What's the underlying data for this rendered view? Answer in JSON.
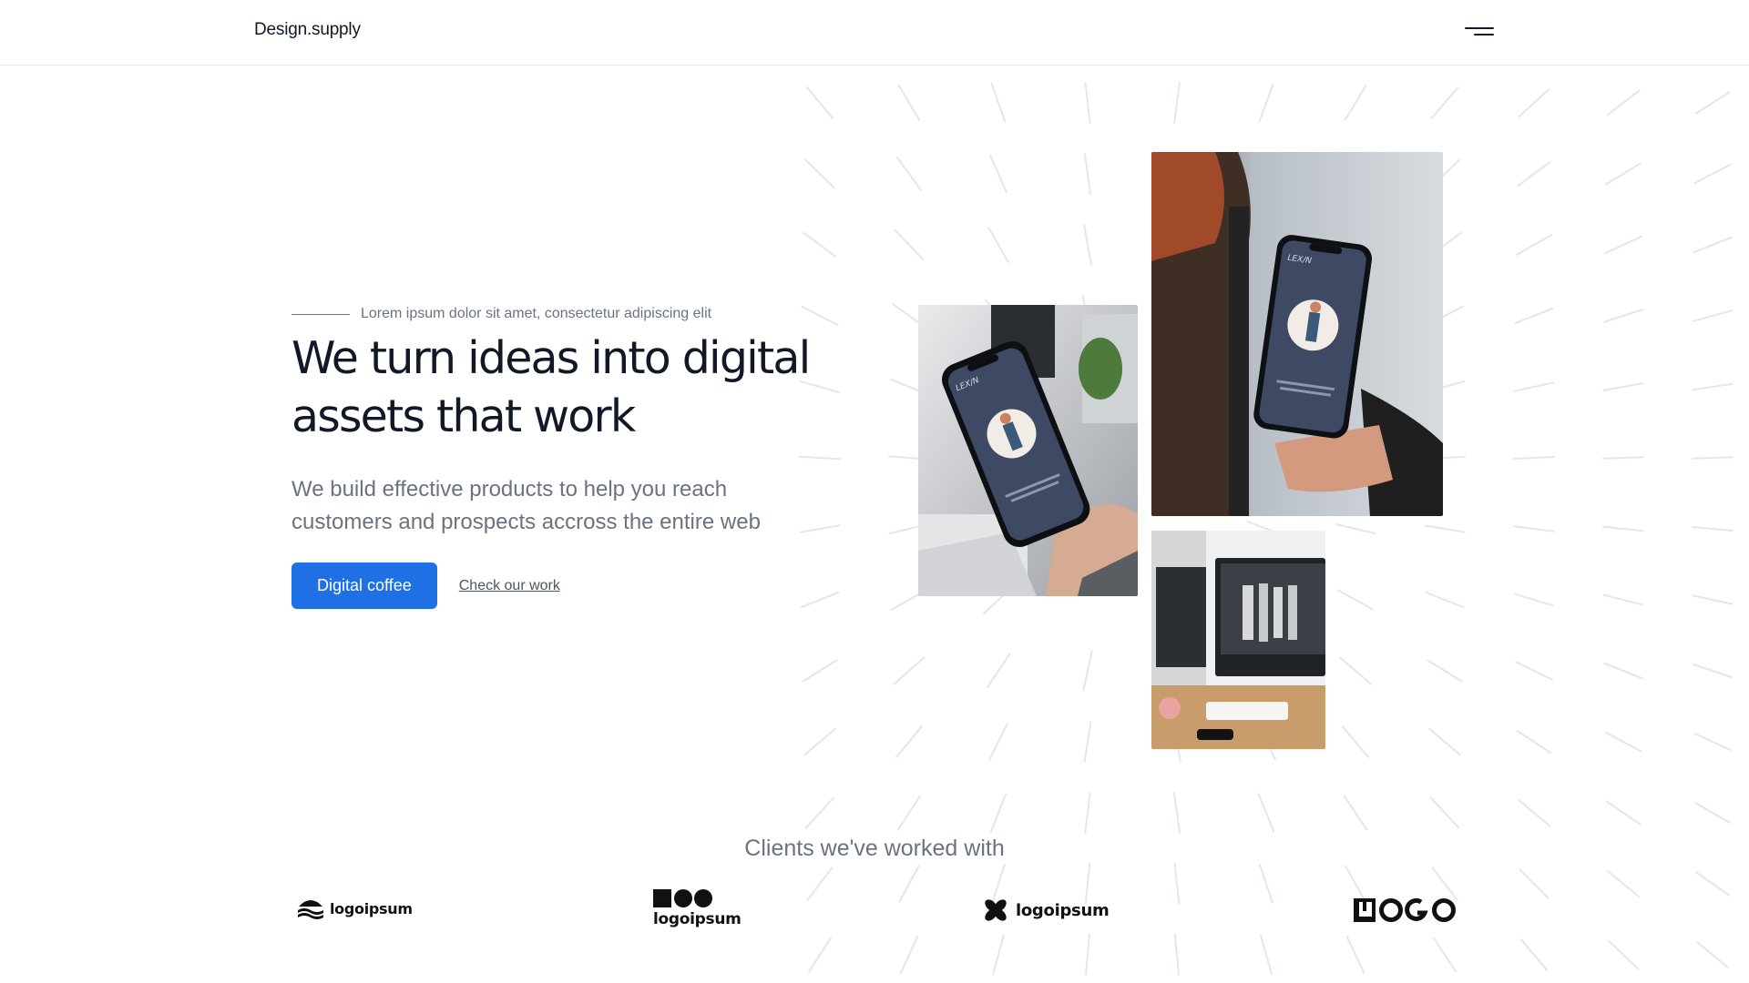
{
  "header": {
    "brand": "Design.supply",
    "menu_icon": "hamburger-menu-icon"
  },
  "hero": {
    "eyebrow": "Lorem ipsum dolor sit amet, consectetur adipiscing elit",
    "headline_line1": "We turn ideas into digital",
    "headline_line2": "assets that work",
    "subtext_line1": "We build effective products to help you reach",
    "subtext_line2": "customers and prospects accross the entire web",
    "primary_button": "Digital coffee",
    "secondary_link": "Check our work"
  },
  "images": {
    "phone_screen_brand": "LEX/N"
  },
  "clients": {
    "title": "Clients we've worked with",
    "logos": [
      {
        "text": "logoipsum",
        "icon": "stacked-waves-logo-icon"
      },
      {
        "text": "logoipsum",
        "icon": "square-circles-logo-icon"
      },
      {
        "text": "logoipsum",
        "icon": "pinwheel-logo-icon"
      },
      {
        "text": "LOGO",
        "icon": "logo-wordmark-icon"
      }
    ]
  },
  "colors": {
    "accent": "#1f6fe5",
    "text_primary": "#111827",
    "text_muted": "#6b7280",
    "pattern": "#e3e6ea"
  }
}
